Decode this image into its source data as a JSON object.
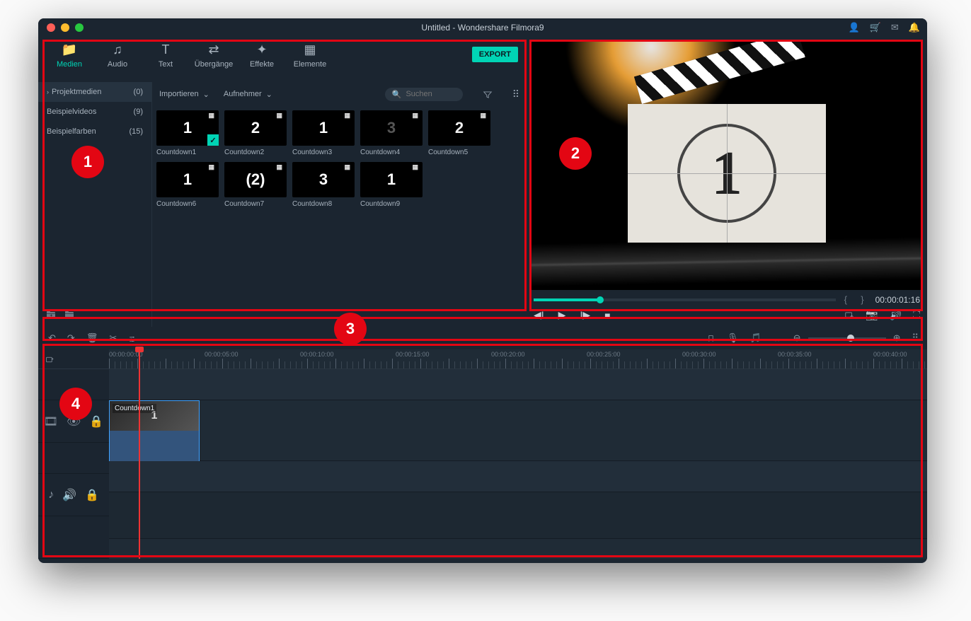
{
  "title": "Untitled - Wondershare Filmora9",
  "header_icons": [
    "person",
    "cart",
    "mail",
    "bell"
  ],
  "categories": [
    {
      "label": "Medien",
      "active": true
    },
    {
      "label": "Audio"
    },
    {
      "label": "Text"
    },
    {
      "label": "Übergänge"
    },
    {
      "label": "Effekte"
    },
    {
      "label": "Elemente"
    }
  ],
  "export_label": "EXPORT",
  "sidebar": [
    {
      "label": "Projektmedien",
      "count": "(0)",
      "expandable": true,
      "active": true
    },
    {
      "label": "Beispielvideos",
      "count": "(9)"
    },
    {
      "label": "Beispielfarben",
      "count": "(15)"
    }
  ],
  "dropdowns": {
    "import": "Importieren",
    "record": "Aufnehmer"
  },
  "search_placeholder": "Suchen",
  "thumbs": [
    {
      "label": "Countdown1",
      "cls": "bg-clap",
      "num": "1",
      "checked": true
    },
    {
      "label": "Countdown2",
      "cls": "bg-clap",
      "num": "2"
    },
    {
      "label": "Countdown3",
      "cls": "bg-red",
      "num": "1"
    },
    {
      "label": "Countdown4",
      "cls": "bg-wht",
      "num": "3"
    },
    {
      "label": "Countdown5",
      "cls": "bg-gry",
      "num": "2"
    },
    {
      "label": "Countdown6",
      "cls": "bg-spc",
      "num": "1"
    },
    {
      "label": "Countdown7",
      "cls": "bg-blr",
      "num": "(2)"
    },
    {
      "label": "Countdown8",
      "cls": "bg-pnk",
      "num": "3"
    },
    {
      "label": "Countdown9",
      "cls": "bg-org",
      "num": "1"
    }
  ],
  "preview": {
    "timecode": "00:00:01:16",
    "big_number": "1"
  },
  "ruler_labels": [
    "00:00:00:00",
    "00:00:05:00",
    "00:00:10:00",
    "00:00:15:00",
    "00:00:20:00",
    "00:00:25:00",
    "00:00:30:00",
    "00:00:35:00",
    "00:00:40:00"
  ],
  "clip_name": "Countdown1",
  "annotations": {
    "a1": "1",
    "a2": "2",
    "a3": "3",
    "a4": "4"
  }
}
